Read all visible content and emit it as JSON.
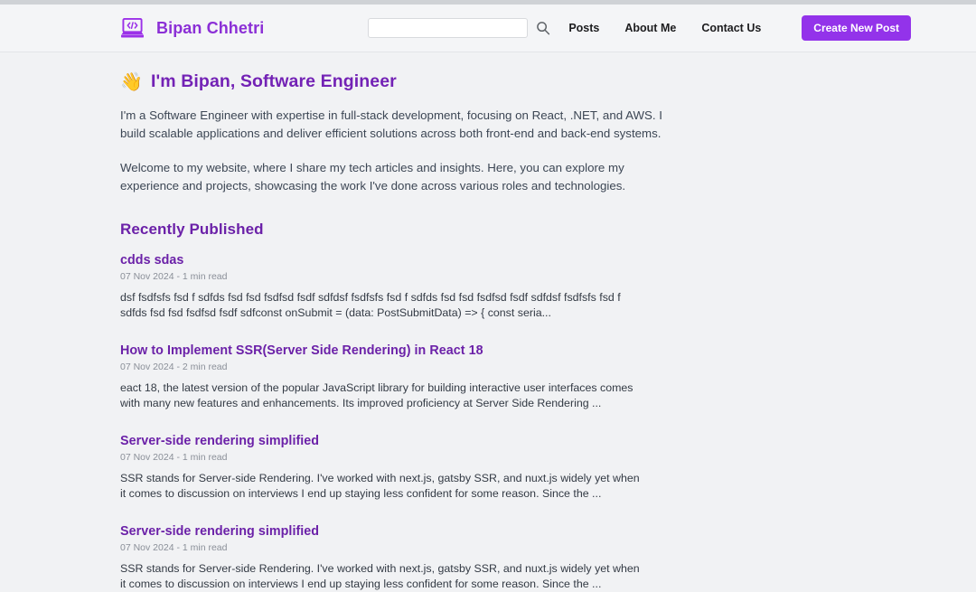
{
  "header": {
    "brand_name": "Bipan Chhetri",
    "brand_icon": "laptop-code-icon",
    "search": {
      "value": "",
      "placeholder": "",
      "icon": "search-icon"
    },
    "nav": [
      {
        "label": "Posts"
      },
      {
        "label": "About Me"
      },
      {
        "label": "Contact Us"
      }
    ],
    "cta_label": "Create New Post"
  },
  "hero": {
    "emoji": "👋",
    "title": "I'm Bipan, Software Engineer",
    "paragraph_1": "I'm a Software Engineer with expertise in full-stack development, focusing on React, .NET, and AWS. I build scalable applications and deliver efficient solutions across both front-end and back-end systems.",
    "paragraph_2": "Welcome to my website, where I share my tech articles and insights. Here, you can explore my experience and projects, showcasing the work I've done across various roles and technologies."
  },
  "main": {
    "section_title": "Recently Published",
    "posts": [
      {
        "title": "cdds sdas",
        "meta": "07 Nov 2024 - 1 min read",
        "excerpt": "dsf fsdfsfs fsd f sdfds fsd fsd fsdfsd fsdf sdfdsf fsdfsfs fsd f sdfds fsd fsd fsdfsd fsdf sdfdsf fsdfsfs fsd f sdfds fsd fsd fsdfsd fsdf sdfconst onSubmit = (data: PostSubmitData) => { const seria..."
      },
      {
        "title": "How to Implement SSR(Server Side Rendering) in React 18",
        "meta": "07 Nov 2024 - 2 min read",
        "excerpt": "eact 18, the latest version of the popular JavaScript library for building interactive user interfaces comes with many new features and enhancements. Its improved proficiency at Server Side Rendering ..."
      },
      {
        "title": "Server-side rendering simplified",
        "meta": "07 Nov 2024 - 1 min read",
        "excerpt": "SSR stands for Server-side Rendering. I've worked with next.js, gatsby SSR, and nuxt.js widely yet when it comes to discussion on interviews I end up staying less confident for some reason. Since the ..."
      },
      {
        "title": "Server-side rendering simplified",
        "meta": "07 Nov 2024 - 1 min read",
        "excerpt": "SSR stands for Server-side Rendering. I've worked with next.js, gatsby SSR, and nuxt.js widely yet when it comes to discussion on interviews I end up staying less confident for some reason. Since the ..."
      }
    ]
  },
  "colors": {
    "brand_purple": "#8b2fd6",
    "heading_purple": "#6b21a8",
    "cta_purple": "#9333ea",
    "page_background": "#f1f2f4",
    "header_background": "#f4f5f7"
  }
}
